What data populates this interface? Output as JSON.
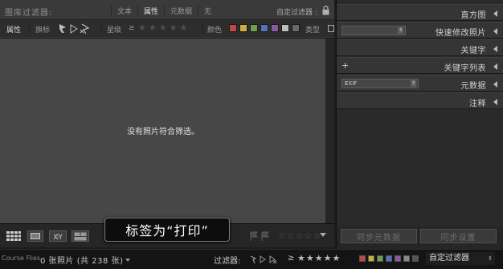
{
  "filter_bar": {
    "title": "图库过滤器:",
    "tabs": [
      {
        "label": "文本",
        "active": false
      },
      {
        "label": "属性",
        "active": true
      },
      {
        "label": "元数据",
        "active": false
      },
      {
        "label": "无",
        "active": false
      }
    ],
    "custom_filter_label": "自定过滤器 :",
    "attr_row": {
      "attribute_label": "属性",
      "flag_label": "旗标",
      "rating_label": "星级",
      "rating_gte": "≥",
      "stars": "★★★★★",
      "color_label": "颜色",
      "type_label": "类型",
      "color_swatches": [
        "#c04848",
        "#c9b040",
        "#6aa050",
        "#5572b8",
        "#8a5aa0",
        "#bdbdbd",
        "#6a6a6a"
      ]
    }
  },
  "grid": {
    "empty_message": "没有照片符合筛选。"
  },
  "tooltip": {
    "text": "标签为“打印”"
  },
  "toolbar": {
    "stars": "☆☆☆☆☆"
  },
  "right_panel": {
    "panels": [
      {
        "label": "直方图"
      },
      {
        "label": "快速修改照片"
      },
      {
        "label": "关键字"
      },
      {
        "label": "关键字列表"
      },
      {
        "label": "元数据",
        "dropdown": "EXIF"
      },
      {
        "label": "注释"
      }
    ],
    "sync_metadata_label": "同步元数据",
    "sync_settings_label": "同步设置"
  },
  "status_bar": {
    "source": "Course Files",
    "count": "0 张照片 (共 238 张)",
    "filter_label": "过滤器:",
    "rating_gte": "≥",
    "stars": "★★★★★",
    "swatch_colors": [
      "#c04848",
      "#c9b040",
      "#6aa050",
      "#5572b8",
      "#8a5aa0",
      "#888888",
      "#555555"
    ],
    "custom_filter": "自定过滤器"
  }
}
